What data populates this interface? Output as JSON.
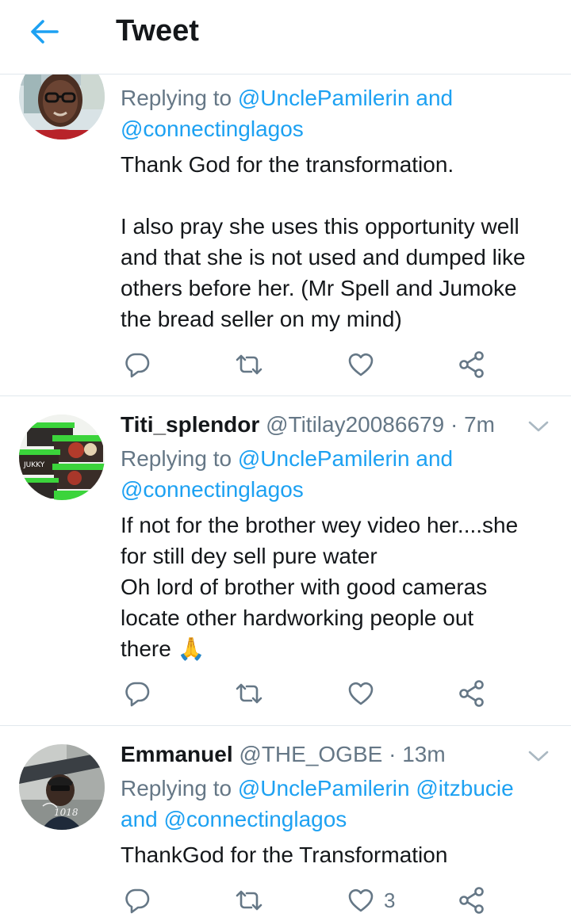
{
  "header": {
    "title": "Tweet"
  },
  "tweets": [
    {
      "display_name": "",
      "handle": "",
      "time": "",
      "replying_prefix": "Replying to",
      "replying_line1_mentions": "@UnclePamilerin",
      "replying_line1_suffix": "and",
      "replying_line2": "@connectinglagos",
      "body_lines": [
        "Thank God for the transformation.",
        "",
        "I also pray she uses this opportunity well",
        "and that she is not used and dumped like",
        "others before her. (Mr Spell and Jumoke",
        "the bread seller on my mind)"
      ],
      "like_count": ""
    },
    {
      "display_name": "Titi_splendor",
      "handle": "@Titilay20086679",
      "separator": "·",
      "time": "7m",
      "replying_prefix": "Replying to",
      "replying_line1_mentions": "@UnclePamilerin",
      "replying_line1_suffix": "and",
      "replying_line2": "@connectinglagos",
      "body_lines": [
        "If not for the brother wey video her....she",
        "for still dey sell pure water",
        "Oh lord of brother with good cameras",
        "locate other hardworking people out",
        "there 🙏"
      ],
      "like_count": ""
    },
    {
      "display_name": "Emmanuel",
      "handle": "@THE_OGBE",
      "separator": "·",
      "time": "13m",
      "replying_prefix": "Replying to",
      "replying_line1_mentions": "@UnclePamilerin @itzbucie",
      "replying_line1_suffix": "",
      "replying_line2_prefix": "and",
      "replying_line2": "@connectinglagos",
      "body_lines": [
        "ThankGod for the Transformation"
      ],
      "like_count": "3"
    }
  ],
  "colors": {
    "accent": "#1da1f2",
    "text": "#14171a",
    "secondary": "#657786",
    "border": "#e1e8ed"
  },
  "icons": {
    "back": "arrow-left-icon",
    "reply": "reply-icon",
    "retweet": "retweet-icon",
    "like": "heart-icon",
    "share": "share-icon",
    "more": "chevron-down-icon"
  }
}
